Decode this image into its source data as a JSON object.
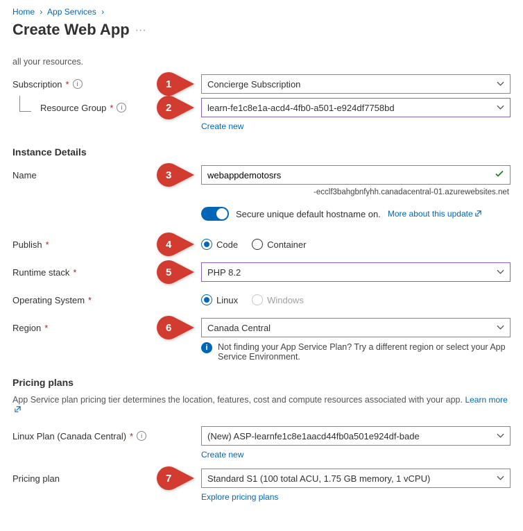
{
  "breadcrumb": {
    "home": "Home",
    "appservices": "App Services"
  },
  "title": "Create Web App",
  "preamble": "all your resources.",
  "labels": {
    "subscription": "Subscription",
    "resourceGroup": "Resource Group",
    "createNew": "Create new",
    "instanceDetails": "Instance Details",
    "name": "Name",
    "publish": "Publish",
    "runtime": "Runtime stack",
    "os": "Operating System",
    "region": "Region",
    "pricingPlans": "Pricing plans",
    "linuxPlan": "Linux Plan (Canada Central)",
    "pricingPlan": "Pricing plan",
    "explorePlans": "Explore pricing plans"
  },
  "values": {
    "subscription": "Concierge Subscription",
    "resourceGroup": "learn-fe1c8e1a-acd4-4fb0-a501-e924df7758bd",
    "name": "webappdemotosrs",
    "nameSuffix": "-ecclf3bahgbnfyhh.canadacentral-01.azurewebsites.net",
    "toggleText": "Secure unique default hostname on.",
    "toggleLink": "More about this update",
    "runtime": "PHP 8.2",
    "region": "Canada Central",
    "regionNote": "Not finding your App Service Plan? Try a different region or select your App Service Environment.",
    "pricingIntro": "App Service plan pricing tier determines the location, features, cost and compute resources associated with your app.",
    "learnMore": "Learn more",
    "linuxPlan": "(New) ASP-learnfe1c8e1aacd44fb0a501e924df-bade",
    "pricingPlan": "Standard S1 (100 total ACU, 1.75 GB memory, 1 vCPU)"
  },
  "radios": {
    "code": "Code",
    "container": "Container",
    "linux": "Linux",
    "windows": "Windows"
  },
  "callouts": [
    "1",
    "2",
    "3",
    "4",
    "5",
    "6",
    "7"
  ]
}
